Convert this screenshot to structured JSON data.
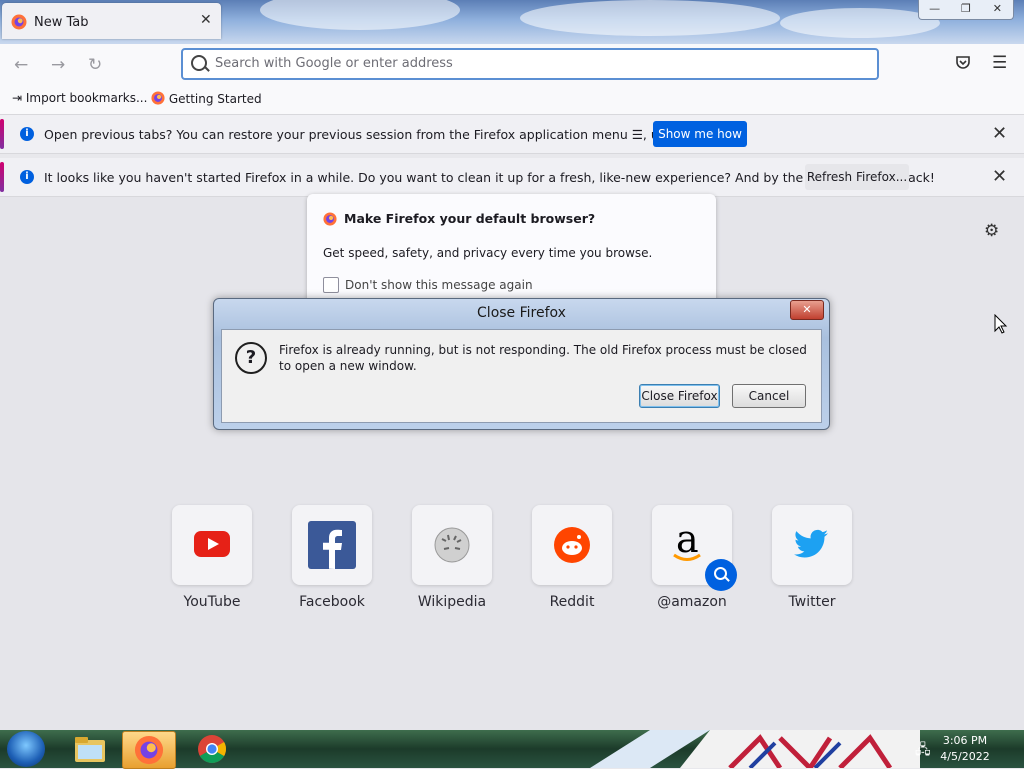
{
  "browser": {
    "tab_title": "New Tab",
    "window_controls": [
      "—",
      "❐",
      "✕"
    ],
    "urlbar_placeholder": "Search with Google or enter address",
    "bookmarks": [
      "Import bookmarks...",
      "Getting Started"
    ]
  },
  "notifications": [
    {
      "message": "Open previous tabs? You can restore your previous session from the Firefox application menu ☰, under History.",
      "button": "Show me how"
    },
    {
      "message": "It looks like you haven't started Firefox in a while. Do you want to clean it up for a fresh, like-new experience? And by the way, welcome back!",
      "button": "Refresh Firefox..."
    }
  ],
  "default_prompt": {
    "title": "Make Firefox your default browser?",
    "description": "Get speed, safety, and privacy every time you browse.",
    "checkbox_label": "Don't show this message again"
  },
  "modal": {
    "title": "Close Firefox",
    "message": "Firefox is already running, but is not responding. The old Firefox process must be closed to open a new window.",
    "primary_button": "Close Firefox",
    "secondary_button": "Cancel"
  },
  "top_sites": [
    {
      "label": "YouTube",
      "icon": "youtube-icon",
      "color": "#e62117"
    },
    {
      "label": "Facebook",
      "icon": "facebook-icon",
      "color": "#3b5998"
    },
    {
      "label": "Wikipedia",
      "icon": "wikipedia-icon",
      "color": "#888888"
    },
    {
      "label": "Reddit",
      "icon": "reddit-icon",
      "color": "#ff4500"
    },
    {
      "label": "@amazon",
      "icon": "amazon-icon",
      "color": "#000000"
    },
    {
      "label": "Twitter",
      "icon": "twitter-icon",
      "color": "#1da1f2"
    }
  ],
  "taskbar": {
    "time": "3:06 PM",
    "date": "4/5/2022"
  }
}
